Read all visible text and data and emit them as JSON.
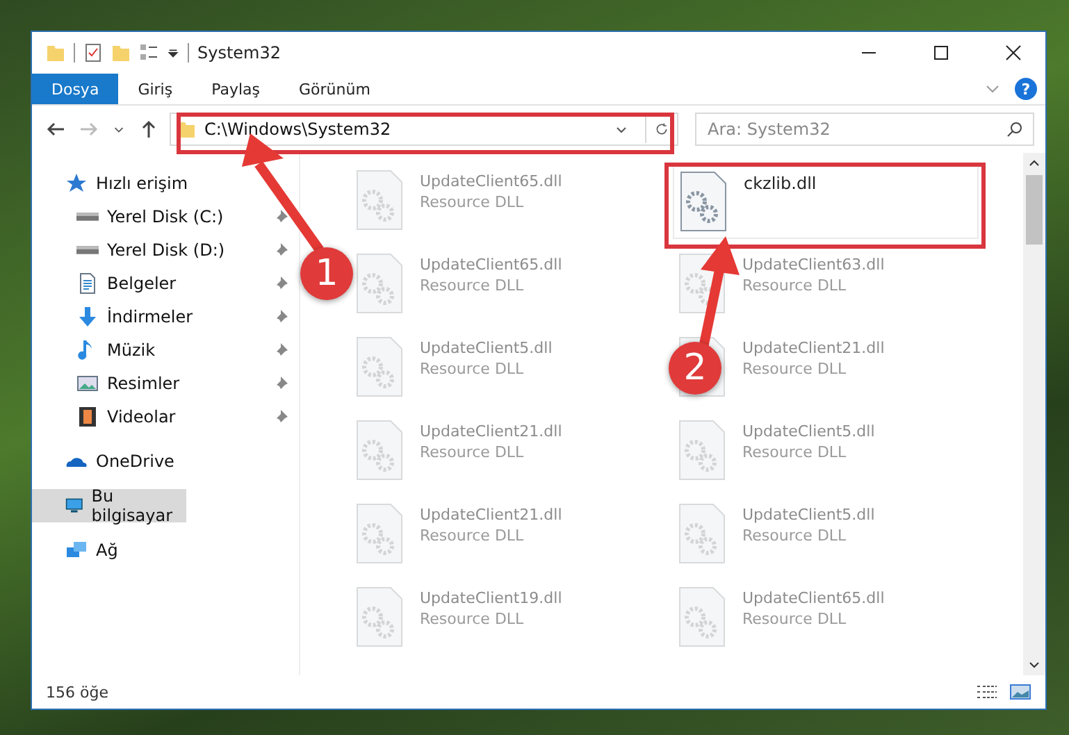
{
  "window": {
    "title": "System32"
  },
  "ribbon": {
    "tabs": [
      {
        "label": "Dosya",
        "selected": true
      },
      {
        "label": "Giriş",
        "selected": false
      },
      {
        "label": "Paylaş",
        "selected": false
      },
      {
        "label": "Görünüm",
        "selected": false
      }
    ]
  },
  "help_button": "?",
  "address_bar": {
    "path": "C:\\Windows\\System32"
  },
  "search": {
    "placeholder": "Ara: System32"
  },
  "sidebar": {
    "items": [
      {
        "label": "Hızlı erişim",
        "kind": "star",
        "selected": false,
        "pinned": false,
        "children": [
          {
            "label": "Yerel Disk (C:)",
            "kind": "drive",
            "selected": false,
            "pinned": true
          },
          {
            "label": "Yerel Disk (D:)",
            "kind": "drive",
            "selected": false,
            "pinned": true
          },
          {
            "label": "Belgeler",
            "kind": "document",
            "selected": false,
            "pinned": true
          },
          {
            "label": "İndirmeler",
            "kind": "download",
            "selected": false,
            "pinned": true
          },
          {
            "label": "Müzik",
            "kind": "music",
            "selected": false,
            "pinned": true
          },
          {
            "label": "Resimler",
            "kind": "pictures",
            "selected": false,
            "pinned": true
          },
          {
            "label": "Videolar",
            "kind": "video",
            "selected": false,
            "pinned": true
          }
        ]
      },
      {
        "label": "OneDrive",
        "kind": "cloud",
        "selected": false,
        "pinned": false
      },
      {
        "label": "Bu bilgisayar",
        "kind": "computer",
        "selected": true,
        "pinned": false
      },
      {
        "label": "Ağ",
        "kind": "network",
        "selected": false,
        "pinned": false
      }
    ]
  },
  "files": [
    {
      "name": "UpdateClient65.dll",
      "type": "Resource DLL",
      "selected": false
    },
    {
      "name": "ckzlib.dll",
      "selected": true
    },
    {
      "name": "UpdateClient65.dll",
      "type": "Resource DLL",
      "selected": false
    },
    {
      "name": "UpdateClient63.dll",
      "type": "Resource DLL",
      "selected": false
    },
    {
      "name": "UpdateClient5.dll",
      "type": "Resource DLL",
      "selected": false
    },
    {
      "name": "UpdateClient21.dll",
      "type": "Resource DLL",
      "selected": false
    },
    {
      "name": "UpdateClient21.dll",
      "type": "Resource DLL",
      "selected": false
    },
    {
      "name": "UpdateClient5.dll",
      "type": "Resource DLL",
      "selected": false
    },
    {
      "name": "UpdateClient21.dll",
      "type": "Resource DLL",
      "selected": false
    },
    {
      "name": "UpdateClient5.dll",
      "type": "Resource DLL",
      "selected": false
    },
    {
      "name": "UpdateClient19.dll",
      "type": "Resource DLL",
      "selected": false
    },
    {
      "name": "UpdateClient65.dll",
      "type": "Resource DLL",
      "selected": false
    }
  ],
  "status_bar": {
    "item_count": "156 öğe"
  },
  "annotations": [
    {
      "number": "1"
    },
    {
      "number": "2"
    }
  ]
}
